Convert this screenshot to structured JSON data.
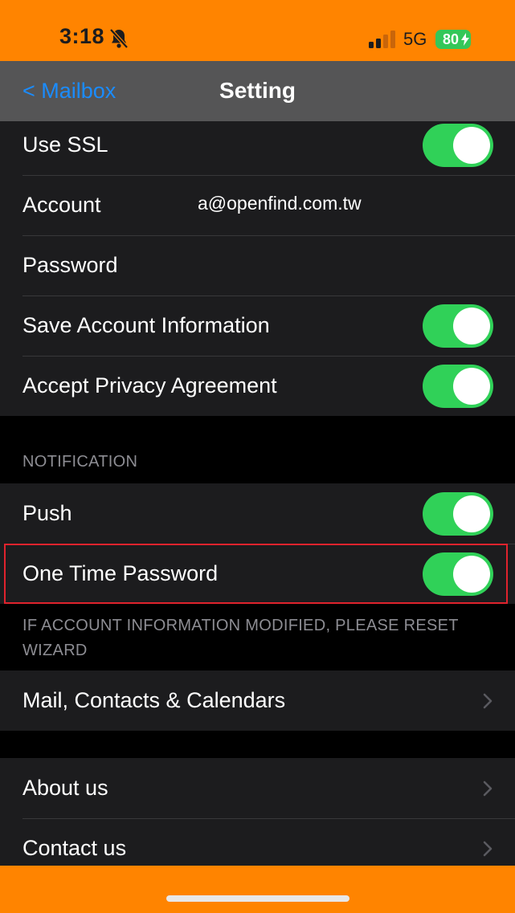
{
  "status_bar": {
    "time": "3:18",
    "network": "5G",
    "battery": "80"
  },
  "nav": {
    "back_label": "< Mailbox",
    "title": "Setting"
  },
  "account_group": {
    "use_ssl": {
      "label": "Use SSL",
      "on": true
    },
    "account": {
      "label": "Account",
      "value": "a@openfind.com.tw"
    },
    "password": {
      "label": "Password"
    },
    "save_account": {
      "label": "Save Account Information",
      "on": true
    },
    "accept_privacy": {
      "label": "Accept Privacy Agreement",
      "on": true
    }
  },
  "notification": {
    "header": "NOTIFICATION",
    "push": {
      "label": "Push",
      "on": true
    },
    "otp": {
      "label": "One Time Password",
      "on": true
    },
    "footer": "IF ACCOUNT INFORMATION MODIFIED, PLEASE RESET WIZARD"
  },
  "mail_group": {
    "mail_contacts": {
      "label": "Mail, Contacts & Calendars"
    }
  },
  "about_group": {
    "about": {
      "label": "About us"
    },
    "contact": {
      "label": "Contact us"
    }
  },
  "colors": {
    "accent": "#ff8400",
    "toggle_on": "#30d158",
    "link": "#1a8cff",
    "highlight": "#e0232d"
  }
}
